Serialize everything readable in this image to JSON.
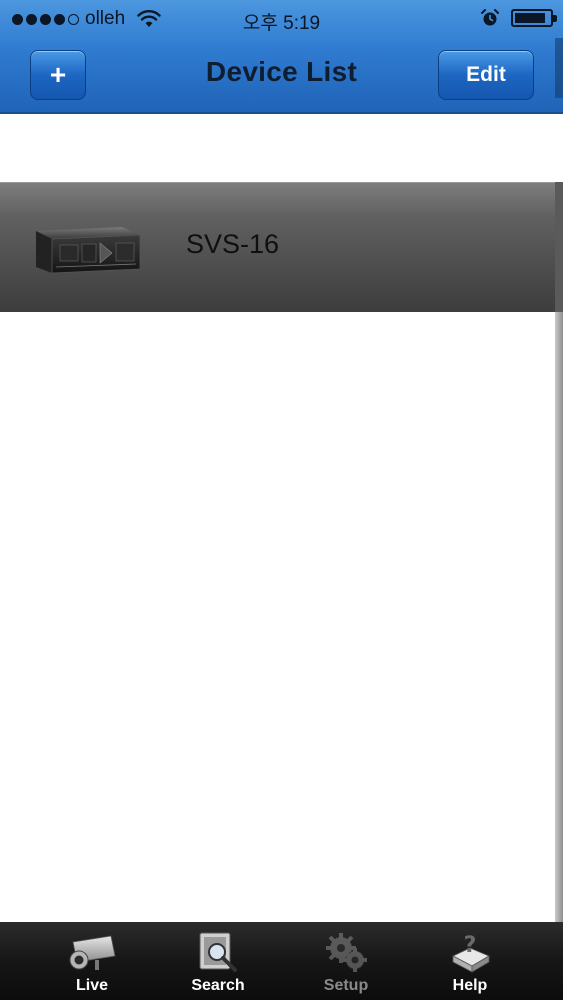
{
  "status_bar": {
    "carrier": "olleh",
    "time": "오후 5:19",
    "signal_dots_filled": 4,
    "signal_dots_total": 5,
    "icons": [
      "wifi-icon",
      "alarm-icon",
      "battery-icon"
    ]
  },
  "nav": {
    "title": "Device List",
    "add_label": "+",
    "edit_label": "Edit"
  },
  "devices": [
    {
      "name": "SVS-16",
      "icon": "dvr-recorder-icon"
    }
  ],
  "tabs": [
    {
      "label": "Live",
      "icon": "camera-icon",
      "enabled": true
    },
    {
      "label": "Search",
      "icon": "search-icon",
      "enabled": true
    },
    {
      "label": "Setup",
      "icon": "gear-icon",
      "enabled": false
    },
    {
      "label": "Help",
      "icon": "help-icon",
      "enabled": true
    }
  ],
  "colors": {
    "nav_bar": "#2f7bd0",
    "button": "#1d66c2",
    "device_row": "#4b4b4b",
    "tab_bar": "#161616"
  }
}
